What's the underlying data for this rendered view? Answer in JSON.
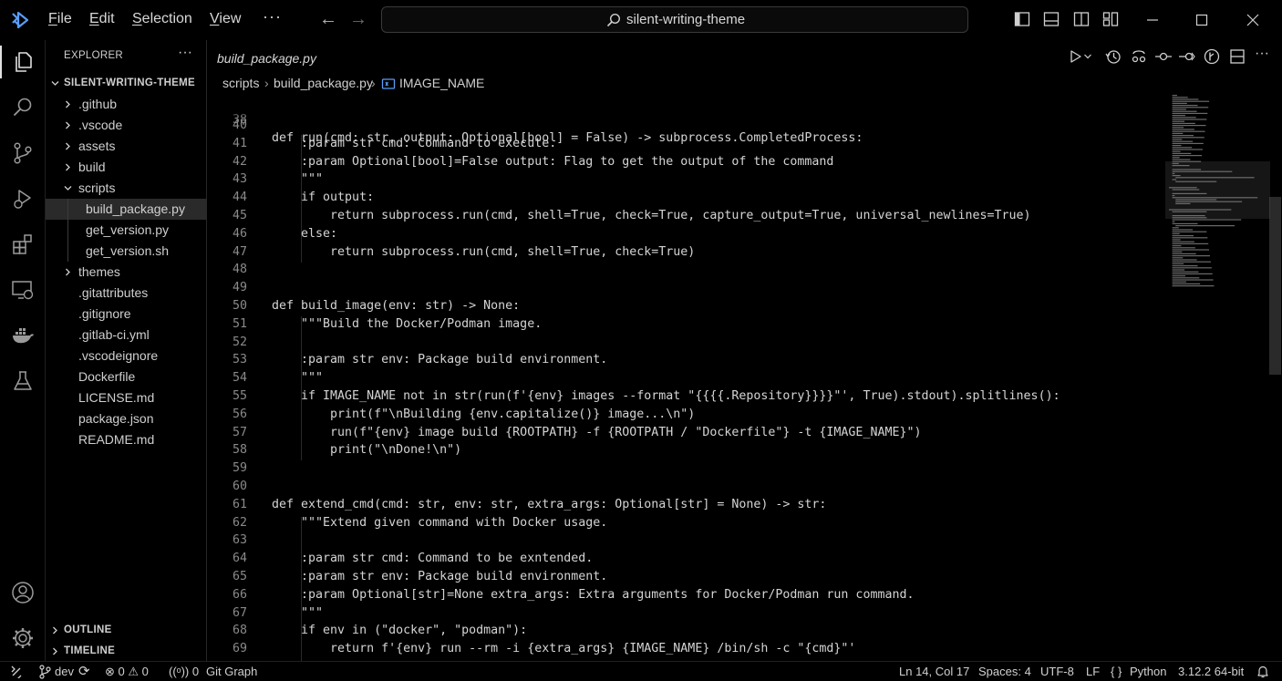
{
  "titlebar": {
    "menus": [
      {
        "label": "File",
        "underline": "F",
        "rest": "ile"
      },
      {
        "label": "Edit",
        "underline": "E",
        "rest": "dit"
      },
      {
        "label": "Selection",
        "underline": "S",
        "rest": "election"
      },
      {
        "label": "View",
        "underline": "V",
        "rest": "iew"
      }
    ],
    "more": "···",
    "search_text": "silent-writing-theme"
  },
  "sidebar": {
    "header": "EXPLORER",
    "header_more": "···",
    "root": "SILENT-WRITING-THEME",
    "items": [
      {
        "label": ".github",
        "type": "folder"
      },
      {
        "label": ".vscode",
        "type": "folder"
      },
      {
        "label": "assets",
        "type": "folder"
      },
      {
        "label": "build",
        "type": "folder"
      },
      {
        "label": "scripts",
        "type": "folder-open"
      },
      {
        "label": "build_package.py",
        "type": "file-nested",
        "selected": true
      },
      {
        "label": "get_version.py",
        "type": "file-nested"
      },
      {
        "label": "get_version.sh",
        "type": "file-nested"
      },
      {
        "label": "themes",
        "type": "folder"
      },
      {
        "label": ".gitattributes",
        "type": "file"
      },
      {
        "label": ".gitignore",
        "type": "file"
      },
      {
        "label": ".gitlab-ci.yml",
        "type": "file"
      },
      {
        "label": ".vscodeignore",
        "type": "file"
      },
      {
        "label": "Dockerfile",
        "type": "file"
      },
      {
        "label": "LICENSE.md",
        "type": "file"
      },
      {
        "label": "package.json",
        "type": "file"
      },
      {
        "label": "README.md",
        "type": "file"
      }
    ],
    "outline": "OUTLINE",
    "timeline": "TIMELINE"
  },
  "editor": {
    "tab": "build_package.py",
    "breadcrumb": {
      "folder": "scripts",
      "file": "build_package.py",
      "symbol": "IMAGE_NAME"
    },
    "sticky_line": {
      "num": "38",
      "text": "def run(cmd: str, output: Optional[bool] = False) -> subprocess.CompletedProcess:"
    },
    "lines": [
      {
        "num": "40",
        "text": ""
      },
      {
        "num": "41",
        "text": "    :param str cmd: Command to execute."
      },
      {
        "num": "42",
        "text": "    :param Optional[bool]=False output: Flag to get the output of the command"
      },
      {
        "num": "43",
        "text": "    \"\"\""
      },
      {
        "num": "44",
        "text": "    if output:"
      },
      {
        "num": "45",
        "text": "        return subprocess.run(cmd, shell=True, check=True, capture_output=True, universal_newlines=True)"
      },
      {
        "num": "46",
        "text": "    else:"
      },
      {
        "num": "47",
        "text": "        return subprocess.run(cmd, shell=True, check=True)"
      },
      {
        "num": "48",
        "text": ""
      },
      {
        "num": "49",
        "text": ""
      },
      {
        "num": "50",
        "text": "def build_image(env: str) -> None:"
      },
      {
        "num": "51",
        "text": "    \"\"\"Build the Docker/Podman image."
      },
      {
        "num": "52",
        "text": ""
      },
      {
        "num": "53",
        "text": "    :param str env: Package build environment."
      },
      {
        "num": "54",
        "text": "    \"\"\""
      },
      {
        "num": "55",
        "text": "    if IMAGE_NAME not in str(run(f'{env} images --format \"{{{{.Repository}}}}\"', True).stdout).splitlines():"
      },
      {
        "num": "56",
        "text": "        print(f\"\\nBuilding {env.capitalize()} image...\\n\")"
      },
      {
        "num": "57",
        "text": "        run(f\"{env} image build {ROOTPATH} -f {ROOTPATH / \"Dockerfile\"} -t {IMAGE_NAME}\")"
      },
      {
        "num": "58",
        "text": "        print(\"\\nDone!\\n\")"
      },
      {
        "num": "59",
        "text": ""
      },
      {
        "num": "60",
        "text": ""
      },
      {
        "num": "61",
        "text": "def extend_cmd(cmd: str, env: str, extra_args: Optional[str] = None) -> str:"
      },
      {
        "num": "62",
        "text": "    \"\"\"Extend given command with Docker usage."
      },
      {
        "num": "63",
        "text": ""
      },
      {
        "num": "64",
        "text": "    :param str cmd: Command to be exntended."
      },
      {
        "num": "65",
        "text": "    :param str env: Package build environment."
      },
      {
        "num": "66",
        "text": "    :param Optional[str]=None extra_args: Extra arguments for Docker/Podman run command."
      },
      {
        "num": "67",
        "text": "    \"\"\""
      },
      {
        "num": "68",
        "text": "    if env in (\"docker\", \"podman\"):"
      },
      {
        "num": "69",
        "text": "        return f'{env} run --rm -i {extra_args} {IMAGE_NAME} /bin/sh -c \"{cmd}\"'"
      }
    ]
  },
  "statusbar": {
    "branch": "dev",
    "errors": "0",
    "warnings": "0",
    "ports": "0",
    "git_graph": "Git Graph",
    "position": "Ln 14, Col 17",
    "spaces": "Spaces: 4",
    "encoding": "UTF-8",
    "eol": "LF",
    "braces": "{ }",
    "language": "Python",
    "interpreter": "3.12.2 64-bit"
  },
  "colors": {
    "background": "#000000",
    "foreground": "#d4d4d4",
    "line_number": "#8a8a8a",
    "selection": "#2a2a2a",
    "accent": "#5a9cf8"
  }
}
